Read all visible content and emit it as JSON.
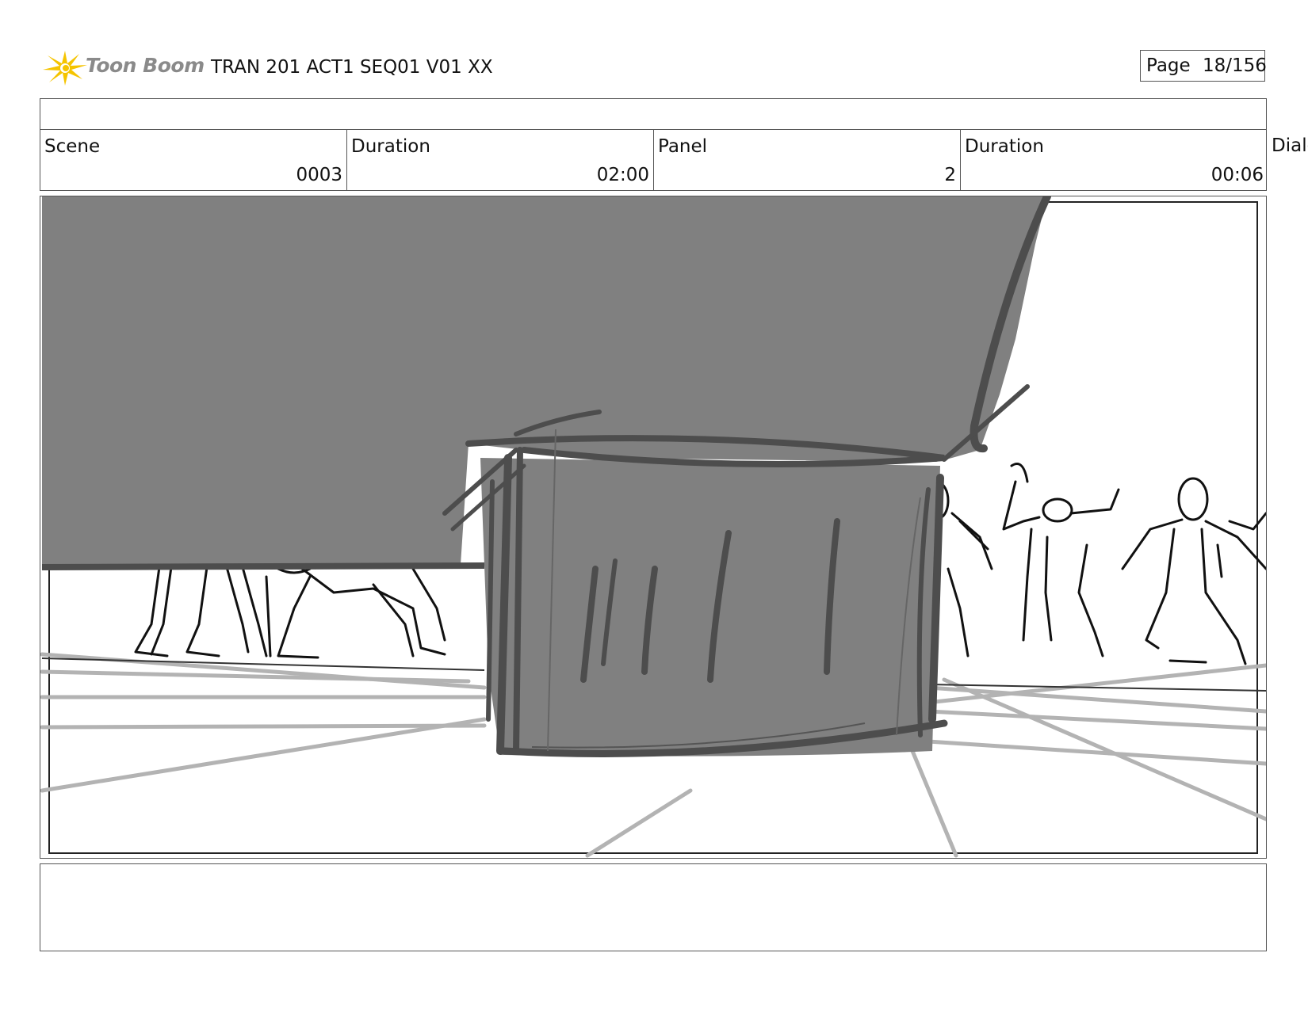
{
  "header": {
    "logo_text": "Toon Boom",
    "doc_title": "TRAN 201 ACT1 SEQ01 V01 XX",
    "page_label": "Page",
    "page_number": "18/156"
  },
  "info": {
    "scene_label": "Scene",
    "scene_value": "0003",
    "scene_duration_label": "Duration",
    "scene_duration_value": "02:00",
    "panel_label": "Panel",
    "panel_value": "2",
    "panel_duration_label": "Duration",
    "panel_duration_value": "00:06",
    "dialog_label": "Dialo"
  },
  "panel_image": {
    "icon": "storyboard-sketch"
  },
  "colors": {
    "logo_star": "#f5c400",
    "sketch_fill": "#808080",
    "sketch_dark": "#4d4d4d",
    "floor_lines": "#b3b3b3"
  }
}
